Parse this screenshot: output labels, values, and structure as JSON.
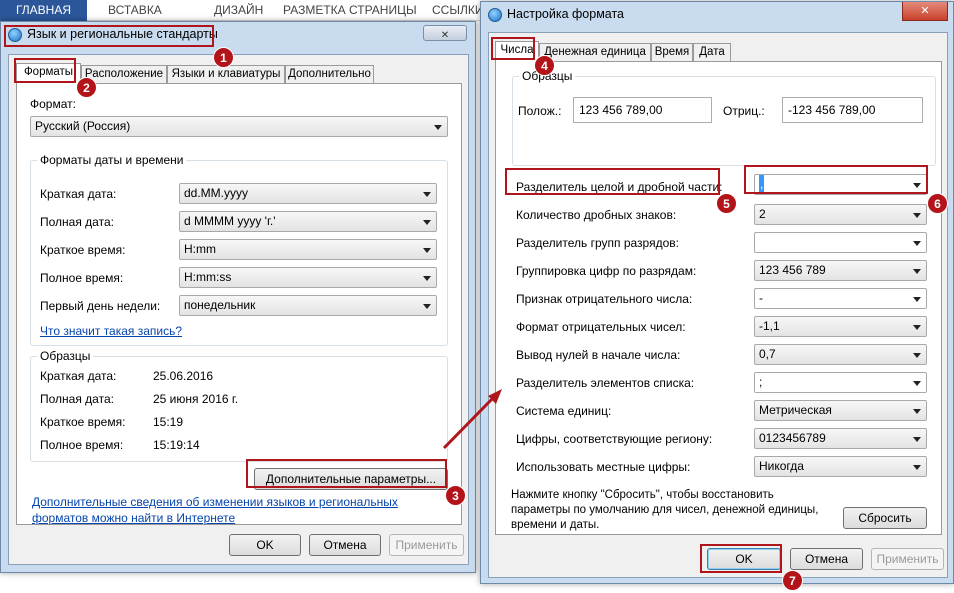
{
  "ribbon": {
    "tabs": [
      "ГЛАВНАЯ",
      "ВСТАВКА",
      "ДИЗАЙН",
      "РАЗМЕТКА СТРАНИЦЫ",
      "ССЫЛКИ"
    ]
  },
  "left_window": {
    "title": "Язык и региональные стандарты",
    "tabs": [
      "Форматы",
      "Расположение",
      "Языки и клавиатуры",
      "Дополнительно"
    ],
    "format_label": "Формат:",
    "format_value": "Русский (Россия)",
    "datetime_group_title": "Форматы даты и времени",
    "rows": [
      {
        "label": "Краткая дата:",
        "value": "dd.MM.yyyy"
      },
      {
        "label": "Полная дата:",
        "value": "d MMMM yyyy 'г.'"
      },
      {
        "label": "Краткое время:",
        "value": "H:mm"
      },
      {
        "label": "Полное время:",
        "value": "H:mm:ss"
      },
      {
        "label": "Первый день недели:",
        "value": "понедельник"
      }
    ],
    "what_link": "Что значит такая запись?",
    "samples_title": "Образцы",
    "samples": [
      {
        "label": "Краткая дата:",
        "value": "25.06.2016"
      },
      {
        "label": "Полная дата:",
        "value": "25 июня 2016 г."
      },
      {
        "label": "Краткое время:",
        "value": "15:19"
      },
      {
        "label": "Полное время:",
        "value": "15:19:14"
      }
    ],
    "advanced_button": "Дополнительные параметры...",
    "info_link_line1": "Дополнительные сведения об изменении языков и региональных",
    "info_link_line2": "форматов можно найти в Интернете",
    "ok": "OK",
    "cancel": "Отмена",
    "apply": "Применить"
  },
  "right_window": {
    "title": "Настройка формата",
    "close_glyph": "✕",
    "tabs": [
      "Числа",
      "Денежная единица",
      "Время",
      "Дата"
    ],
    "samples_title": "Образцы",
    "positive_label": "Полож.:",
    "positive_value": "123 456 789,00",
    "negative_label": "Отриц.:",
    "negative_value": "-123 456 789,00",
    "rows": [
      {
        "label": "Разделитель целой и дробной части:",
        "value": ","
      },
      {
        "label": "Количество дробных знаков:",
        "value": "2"
      },
      {
        "label": "Разделитель групп разрядов:",
        "value": ""
      },
      {
        "label": "Группировка цифр по разрядам:",
        "value": "123 456 789"
      },
      {
        "label": "Признак отрицательного числа:",
        "value": "-"
      },
      {
        "label": "Формат отрицательных чисел:",
        "value": "-1,1"
      },
      {
        "label": "Вывод нулей в начале числа:",
        "value": "0,7"
      },
      {
        "label": "Разделитель элементов списка:",
        "value": ";"
      },
      {
        "label": "Система единиц:",
        "value": "Метрическая"
      },
      {
        "label": "Цифры, соответствующие региону:",
        "value": "0123456789"
      },
      {
        "label": "Использовать местные цифры:",
        "value": "Никогда"
      }
    ],
    "reset_text_line1": "Нажмите кнопку \"Сбросить\", чтобы восстановить",
    "reset_text_line2": "параметры по умолчанию для чисел, денежной единицы,",
    "reset_text_line3": "времени и даты.",
    "reset_button": "Сбросить",
    "ok": "OK",
    "cancel": "Отмена",
    "apply": "Применить"
  },
  "badges": [
    "1",
    "2",
    "3",
    "4",
    "5",
    "6",
    "7"
  ],
  "colors": {
    "highlight_red": "#b0151b",
    "badge_red": "#b3141a",
    "link_blue": "#0645ad",
    "ribbon_blue": "#2b579a"
  }
}
